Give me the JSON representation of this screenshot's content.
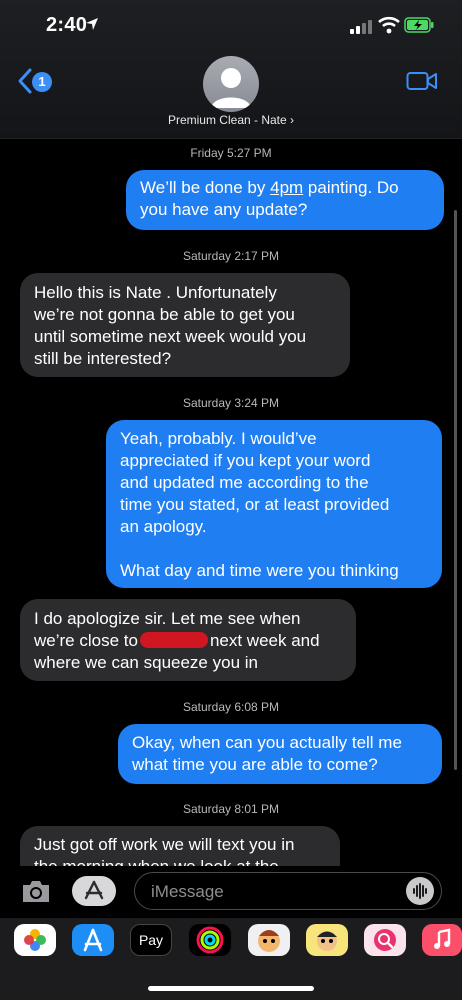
{
  "status_bar": {
    "time": "2:40"
  },
  "header": {
    "back_badge": "1",
    "contact_name": "Premium Clean - Nate ›"
  },
  "conversation": [
    {
      "type": "timestamp",
      "text": "Friday 5:27 PM"
    },
    {
      "type": "outgoing",
      "lines": [
        "We’ll be done by ",
        "4pm",
        " painting. Do\nyou have any update?"
      ]
    },
    {
      "type": "timestamp",
      "text": "Saturday 2:17 PM"
    },
    {
      "type": "incoming",
      "text": "Hello this is Nate . Unfortunately\nwe’re not gonna be able to get you\nuntil sometime next week would you\nstill be interested?"
    },
    {
      "type": "timestamp",
      "text": "Saturday 3:24 PM"
    },
    {
      "type": "outgoing",
      "text": "Yeah, probably. I would’ve\nappreciated if you kept your word\nand updated me according to the\ntime you stated, or at least provided\nan apology.\n\nWhat day and time were you thinking"
    },
    {
      "type": "incoming",
      "parts": [
        "I do apologize sir. Let me see when\nwe’re close to",
        "next week and\nwhere we can squeeze you in"
      ]
    },
    {
      "type": "timestamp",
      "text": "Saturday 6:08 PM"
    },
    {
      "type": "outgoing",
      "text": "Okay, when can you actually tell me\nwhat time you are able to come?"
    },
    {
      "type": "timestamp",
      "text": "Saturday 8:01 PM"
    },
    {
      "type": "incoming",
      "text": "Just got off work we will text you in\nthe morning when we look at the"
    }
  ],
  "input": {
    "placeholder": "iMessage"
  },
  "app_drawer": {
    "apps": [
      "photos-app",
      "app-store",
      "apple-pay",
      "fitness",
      "memoji-1",
      "memoji-2",
      "search-web",
      "music"
    ],
    "apple_pay_label": "Pay"
  },
  "colors": {
    "outgoing": "#1e7ef2",
    "incoming": "#2c2c2e",
    "accent": "#3b8ff6"
  }
}
